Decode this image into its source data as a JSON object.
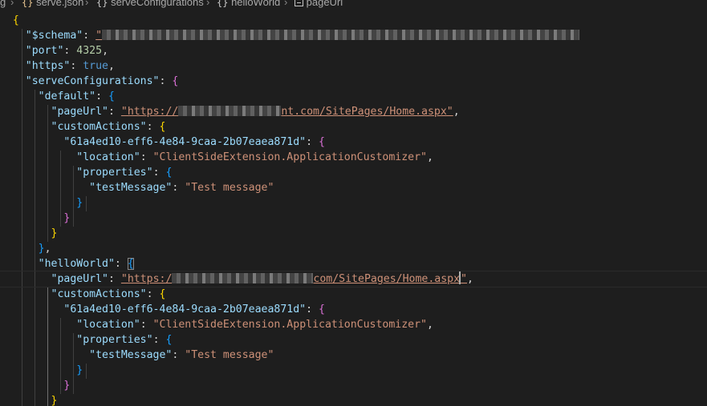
{
  "breadcrumb": {
    "items": [
      {
        "label": "g",
        "icon": "none"
      },
      {
        "label": "serve.json",
        "icon": "json-braces-icon"
      },
      {
        "label": "serveConfigurations",
        "icon": "object-braces-icon"
      },
      {
        "label": "helloWorld",
        "icon": "object-braces-icon"
      },
      {
        "label": "pageUrl",
        "icon": "string-property-icon"
      }
    ],
    "separator": ">"
  },
  "editor": {
    "lines": {
      "l1": "{",
      "l2_key": "\"$schema\"",
      "l3_key": "\"port\"",
      "l3_val": "4325",
      "l4_key": "\"https\"",
      "l4_val": "true",
      "l5_key": "\"serveConfigurations\"",
      "l6_key": "\"default\"",
      "l7_key": "\"pageUrl\"",
      "l7_val_a": "\"https://",
      "l7_val_b": "nt.com/SitePages/Home.aspx\"",
      "l8_key": "\"customActions\"",
      "l9_key": "\"61a4ed10-eff6-4e84-9caa-2b07eaea871d\"",
      "l10_key": "\"location\"",
      "l10_val": "\"ClientSideExtension.ApplicationCustomizer\"",
      "l11_key": "\"properties\"",
      "l12_key": "\"testMessage\"",
      "l12_val": "\"Test message\"",
      "l17_key": "\"helloWorld\"",
      "l18_key": "\"pageUrl\"",
      "l18_val_a": "\"https:/",
      "l18_val_b": "com/SitePages/Home.aspx",
      "l18_val_c": "\"",
      "l19_key": "\"customActions\"",
      "l20_key": "\"61a4ed10-eff6-4e84-9caa-2b07eaea871d\"",
      "l21_key": "\"location\"",
      "l21_val": "\"ClientSideExtension.ApplicationCustomizer\"",
      "l22_key": "\"properties\"",
      "l23_key": "\"testMessage\"",
      "l23_val": "\"Test message\""
    }
  },
  "colors": {
    "background": "#1e1e1e",
    "key": "#9cdcfe",
    "string": "#ce9178",
    "number": "#b5cea8",
    "keyword": "#569cd6",
    "bracket_level1": "#ffd700",
    "bracket_level2": "#da70d6",
    "bracket_level3": "#179fff"
  }
}
